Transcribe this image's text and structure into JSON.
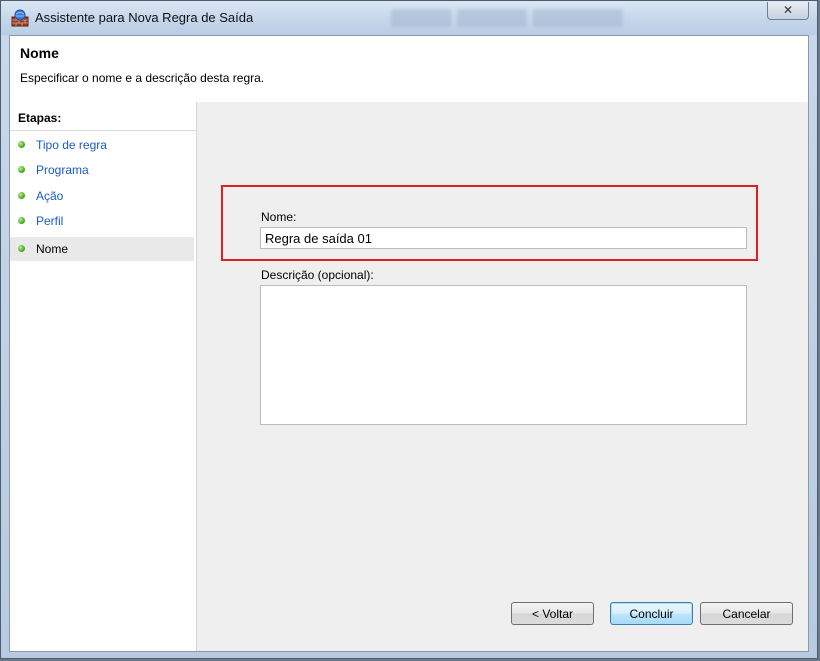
{
  "window": {
    "title": "Assistente para Nova Regra de Saída",
    "close_symbol": "✕"
  },
  "header": {
    "title": "Nome",
    "subtitle": "Especificar o nome e a descrição desta regra."
  },
  "steps": {
    "title": "Etapas:",
    "items": [
      {
        "label": "Tipo de regra",
        "icon": "green-dot-icon"
      },
      {
        "label": "Programa",
        "icon": "green-dot-icon"
      },
      {
        "label": "Ação",
        "icon": "green-dot-icon"
      },
      {
        "label": "Perfil",
        "icon": "green-dot-icon"
      },
      {
        "label": "Nome",
        "icon": "green-dot-icon",
        "current": true
      }
    ]
  },
  "form": {
    "name_label": "Nome:",
    "name_value": "Regra de saída 01",
    "description_label": "Descrição (opcional):",
    "description_value": ""
  },
  "buttons": {
    "back": "< Voltar",
    "finish": "Concluir",
    "cancel": "Cancelar"
  },
  "colors": {
    "link": "#1a5bc4",
    "highlight_border": "#e02020",
    "step_dot": "#3f9e1c"
  }
}
